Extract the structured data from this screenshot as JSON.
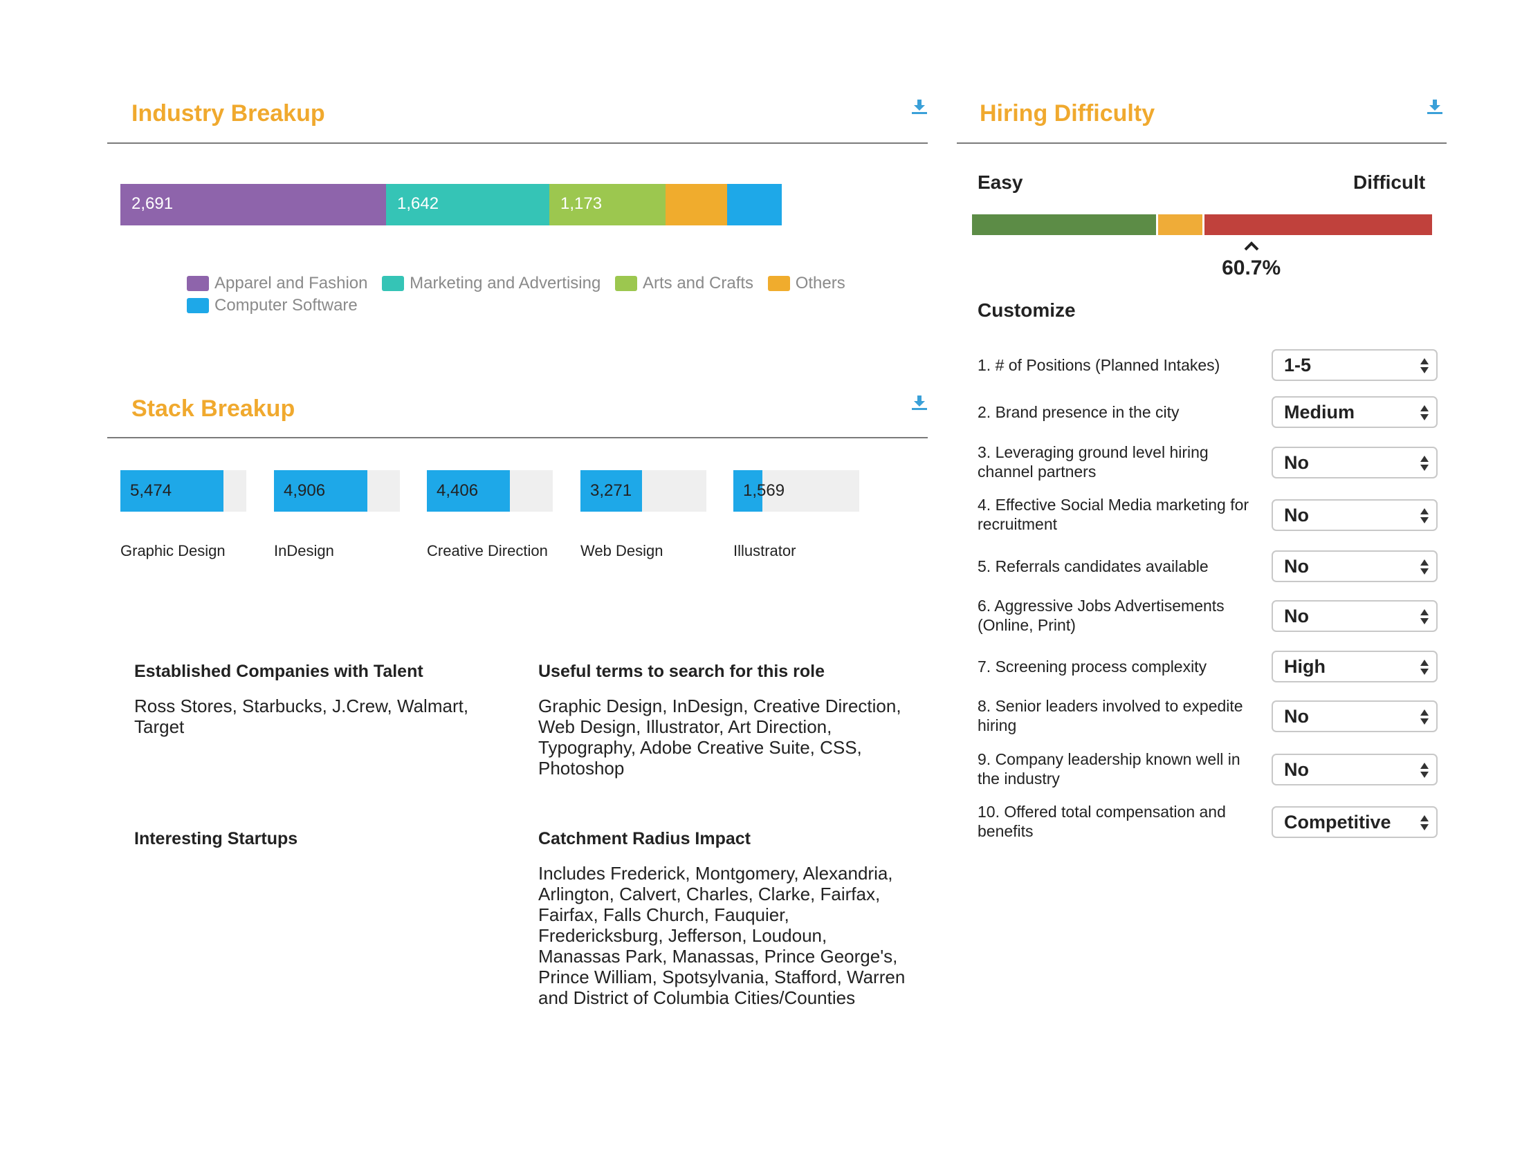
{
  "industry": {
    "title": "Industry Breakup",
    "download_icon": "download-icon",
    "segments": [
      {
        "name": "Apparel and Fashion",
        "value": "2,691",
        "color": "#8e64ab"
      },
      {
        "name": "Marketing and Advertising",
        "value": "1,642",
        "color": "#35c4b6"
      },
      {
        "name": "Arts and Crafts",
        "value": "1,173",
        "color": "#9cc74f"
      },
      {
        "name": "Others",
        "value": "",
        "color": "#f0ac2d"
      },
      {
        "name": "Computer Software",
        "value": "",
        "color": "#1ea8e8"
      }
    ]
  },
  "stack": {
    "title": "Stack Breakup",
    "download_icon": "download-icon",
    "items": [
      {
        "label": "Graphic Design",
        "value": "5,474",
        "fraction": 0.82
      },
      {
        "label": "InDesign",
        "value": "4,906",
        "fraction": 0.74
      },
      {
        "label": "Creative Direction",
        "value": "4,406",
        "fraction": 0.66
      },
      {
        "label": "Web Design",
        "value": "3,271",
        "fraction": 0.49
      },
      {
        "label": "Illustrator",
        "value": "1,569",
        "fraction": 0.23
      }
    ]
  },
  "info": {
    "established_title": "Established Companies with Talent",
    "established_body": "Ross Stores, Starbucks, J.Crew, Walmart, Target",
    "terms_title": "Useful terms to search for this role",
    "terms_body": "Graphic Design, InDesign, Creative Direction, Web Design, Illustrator, Art Direction, Typography, Adobe Creative Suite, CSS, Photoshop",
    "startups_title": "Interesting Startups",
    "catchment_title": "Catchment Radius Impact",
    "catchment_body": "Includes Frederick, Montgomery, Alexandria, Arlington, Calvert, Charles, Clarke, Fairfax, Fairfax, Falls Church, Fauquier, Fredericksburg, Jefferson, Loudoun, Manassas Park, Manassas, Prince George's, Prince William, Spotsylvania, Stafford, Warren and District of Columbia Cities/Counties"
  },
  "hiring": {
    "title": "Hiring Difficulty",
    "download_icon": "download-icon",
    "easy_label": "Easy",
    "difficult_label": "Difficult",
    "level_percent": 60.7,
    "level_text": "60.7%",
    "scale_colors": [
      "#5c8c46",
      "#efac38",
      "#c0413c"
    ],
    "customize_title": "Customize",
    "questions": [
      {
        "text": "1. # of Positions (Planned Intakes)",
        "value": "1-5"
      },
      {
        "text": "2. Brand presence in the city",
        "value": "Medium"
      },
      {
        "text": "3. Leveraging ground level hiring channel partners",
        "value": "No"
      },
      {
        "text": "4. Effective Social Media marketing for recruitment",
        "value": "No"
      },
      {
        "text": "5. Referrals candidates available",
        "value": "No"
      },
      {
        "text": "6. Aggressive Jobs Advertisements (Online, Print)",
        "value": "No"
      },
      {
        "text": "7. Screening process complexity",
        "value": "High"
      },
      {
        "text": "8. Senior leaders involved to expedite hiring",
        "value": "No"
      },
      {
        "text": "9. Company leadership known well in the industry",
        "value": "No"
      },
      {
        "text": "10. Offered total compensation and benefits",
        "value": "Competitive"
      }
    ]
  }
}
